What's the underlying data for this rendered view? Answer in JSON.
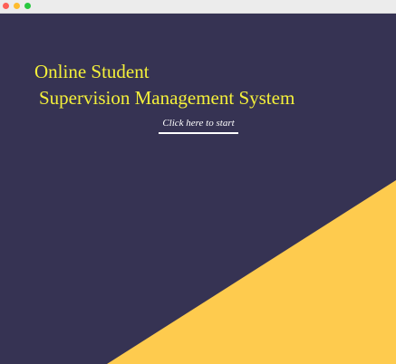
{
  "window": {
    "controls": [
      "close",
      "minimize",
      "zoom"
    ]
  },
  "hero": {
    "title_line1": "Online Student",
    "title_line2": "Supervision Management System",
    "start_link": "Click here to start"
  },
  "colors": {
    "background": "#363353",
    "accent_wedge": "#fecb4e",
    "title": "#f4f03a",
    "link": "#ffffff"
  }
}
